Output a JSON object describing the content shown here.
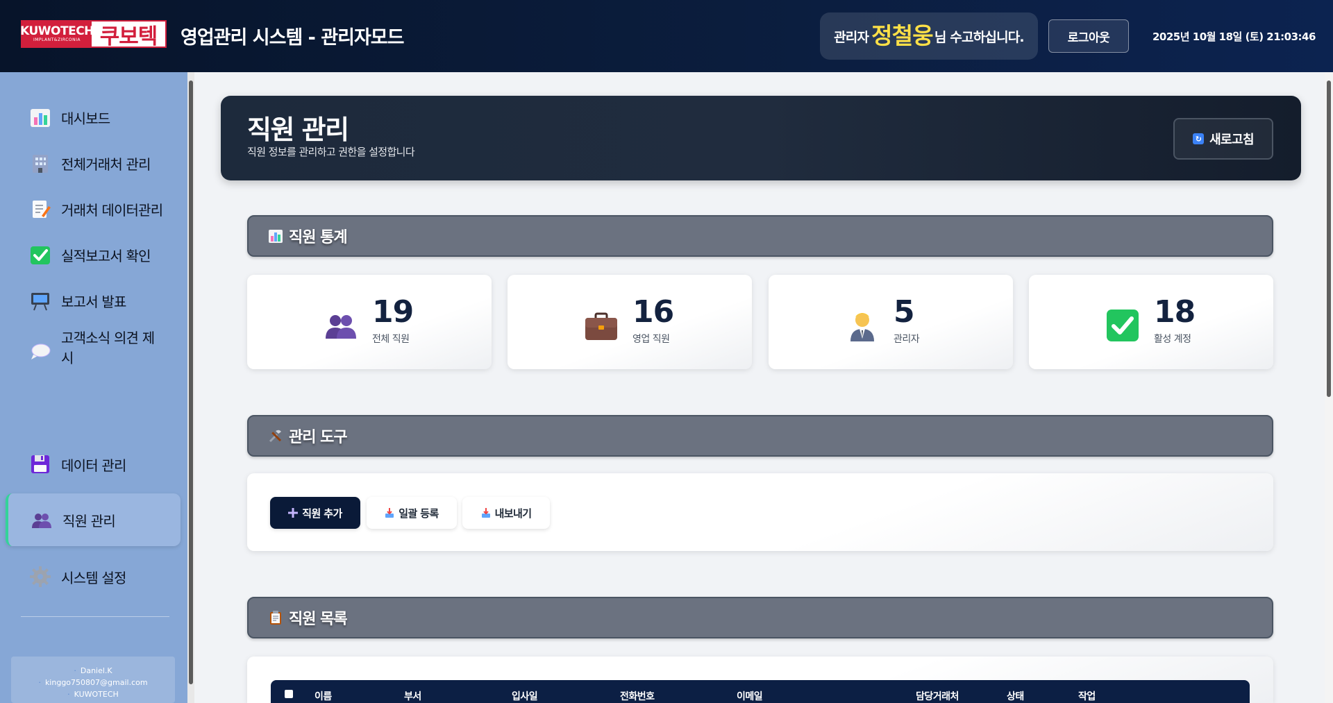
{
  "header": {
    "logo_brand": "KUWOTECH",
    "logo_sub": "IMPLANT&ZIRCONIA",
    "logo_kr": "쿠보텍",
    "title": "영업관리 시스템 - 관리자모드",
    "greeting_prefix": "관리자",
    "user_name": "정철웅",
    "greeting_suffix": "님 수고하십니다.",
    "logout_label": "로그아웃",
    "datetime": "2025년 10월 18일 (토) 21:03:46"
  },
  "sidebar": {
    "items": [
      {
        "label": "대시보드",
        "icon": "bar-chart-icon"
      },
      {
        "label": "전체거래처 관리",
        "icon": "building-icon"
      },
      {
        "label": "거래처 데이터관리",
        "icon": "memo-icon"
      },
      {
        "label": "실적보고서 확인",
        "icon": "check-mark-icon"
      },
      {
        "label": "보고서 발표",
        "icon": "presentation-icon"
      },
      {
        "label": "고객소식 의견 제시",
        "icon": "speech-bubble-icon"
      },
      {
        "label": "데이터 관리",
        "icon": "floppy-disk-icon"
      },
      {
        "label": "직원 관리",
        "icon": "people-icon",
        "active": true
      },
      {
        "label": "시스템 설정",
        "icon": "gear-icon"
      }
    ],
    "info": {
      "developer": "Daniel.K",
      "email": "kinggo750807@gmail.com",
      "company": "KUWOTECH"
    }
  },
  "hero": {
    "title": "직원 관리",
    "subtitle": "직원 정보를 관리하고 권한을 설정합니다",
    "refresh_label": "새로고침"
  },
  "stats_section": {
    "title": "직원 통계",
    "cards": [
      {
        "value": "19",
        "label": "전체 직원",
        "icon": "people-icon"
      },
      {
        "value": "16",
        "label": "영업 직원",
        "icon": "briefcase-icon"
      },
      {
        "value": "5",
        "label": "관리자",
        "icon": "manager-icon"
      },
      {
        "value": "18",
        "label": "활성 계정",
        "icon": "check-box-icon"
      }
    ]
  },
  "tools_section": {
    "title": "관리 도구",
    "buttons": [
      {
        "label": "직원 추가",
        "icon": "plus-icon"
      },
      {
        "label": "일괄 등록",
        "icon": "inbox-tray-icon"
      },
      {
        "label": "내보내기",
        "icon": "inbox-tray-icon"
      }
    ]
  },
  "list_section": {
    "title": "직원 목록",
    "columns": [
      "이름",
      "부서",
      "입사일",
      "전화번호",
      "이메일",
      "담당거래처",
      "상태",
      "작업"
    ]
  },
  "colors": {
    "header_bg": "#0b1d3d",
    "sidebar_bg": "#86a7d6",
    "accent_green": "#34d399",
    "section_bar": "#6b7280",
    "primary_button": "#0a1a38",
    "name_highlight": "#fde047"
  }
}
